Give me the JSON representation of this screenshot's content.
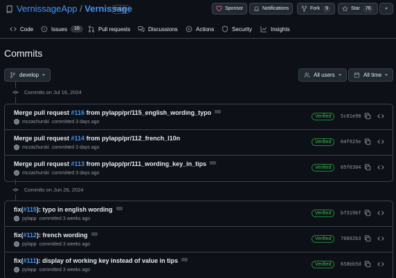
{
  "repo": {
    "owner": "VernissageApp",
    "separator": " / ",
    "name": "Vernissage",
    "visibility": "Public"
  },
  "actions": {
    "sponsor": "Sponsor",
    "notifications": "Notifications",
    "fork": "Fork",
    "fork_count": "9",
    "star": "Star",
    "star_count": "76"
  },
  "nav": {
    "code": "Code",
    "issues": "Issues",
    "issues_count": "16",
    "pull_requests": "Pull requests",
    "discussions": "Discussions",
    "actions": "Actions",
    "security": "Security",
    "insights": "Insights"
  },
  "page": {
    "title": "Commits"
  },
  "filters": {
    "branch": "develop",
    "users": "All users",
    "time": "All time"
  },
  "groups": [
    {
      "heading": "Commits on Jul 16, 2024",
      "commits": [
        {
          "prefix": "Merge pull request ",
          "pr": "#116",
          "suffix": " from pylapp/pr/115_english_wording_typo",
          "author": "mczachurski",
          "when": "committed 3 days ago",
          "badge": "Verified",
          "sha": "5c01e98"
        },
        {
          "prefix": "Merge pull request ",
          "pr": "#114",
          "suffix": " from pylapp/pr/112_french_l10n",
          "author": "mczachurski",
          "when": "committed 3 days ago",
          "badge": "Verified",
          "sha": "64f925e"
        },
        {
          "prefix": "Merge pull request ",
          "pr": "#113",
          "suffix": " from pylapp/pr/111_wording_key_in_tips",
          "author": "mczachurski",
          "when": "committed 3 days ago",
          "badge": "Verified",
          "sha": "05f6304"
        }
      ]
    },
    {
      "heading": "Commits on Jun 26, 2024",
      "commits": [
        {
          "prefix": "fix(",
          "pr": "#115",
          "suffix": "): typo in english wording",
          "author": "pylapp",
          "when": "committed 3 weeks ago",
          "badge": "Verified",
          "sha": "bf319bf"
        },
        {
          "prefix": "fix(",
          "pr": "#112",
          "suffix": "): french wording",
          "author": "pylapp",
          "when": "committed 3 weeks ago",
          "badge": "Verified",
          "sha": "76602b3"
        },
        {
          "prefix": "fix(",
          "pr": "#111",
          "suffix": "): display of working key instead of value in tips",
          "author": "pylapp",
          "when": "committed 3 weeks ago",
          "badge": "Verified",
          "sha": "658bb5d"
        }
      ]
    }
  ],
  "colors": {
    "background": "#0d1117",
    "link": "#4493f8",
    "verified": "#3fb950",
    "border": "#3d444d",
    "sponsor_heart": "#db61a2"
  }
}
